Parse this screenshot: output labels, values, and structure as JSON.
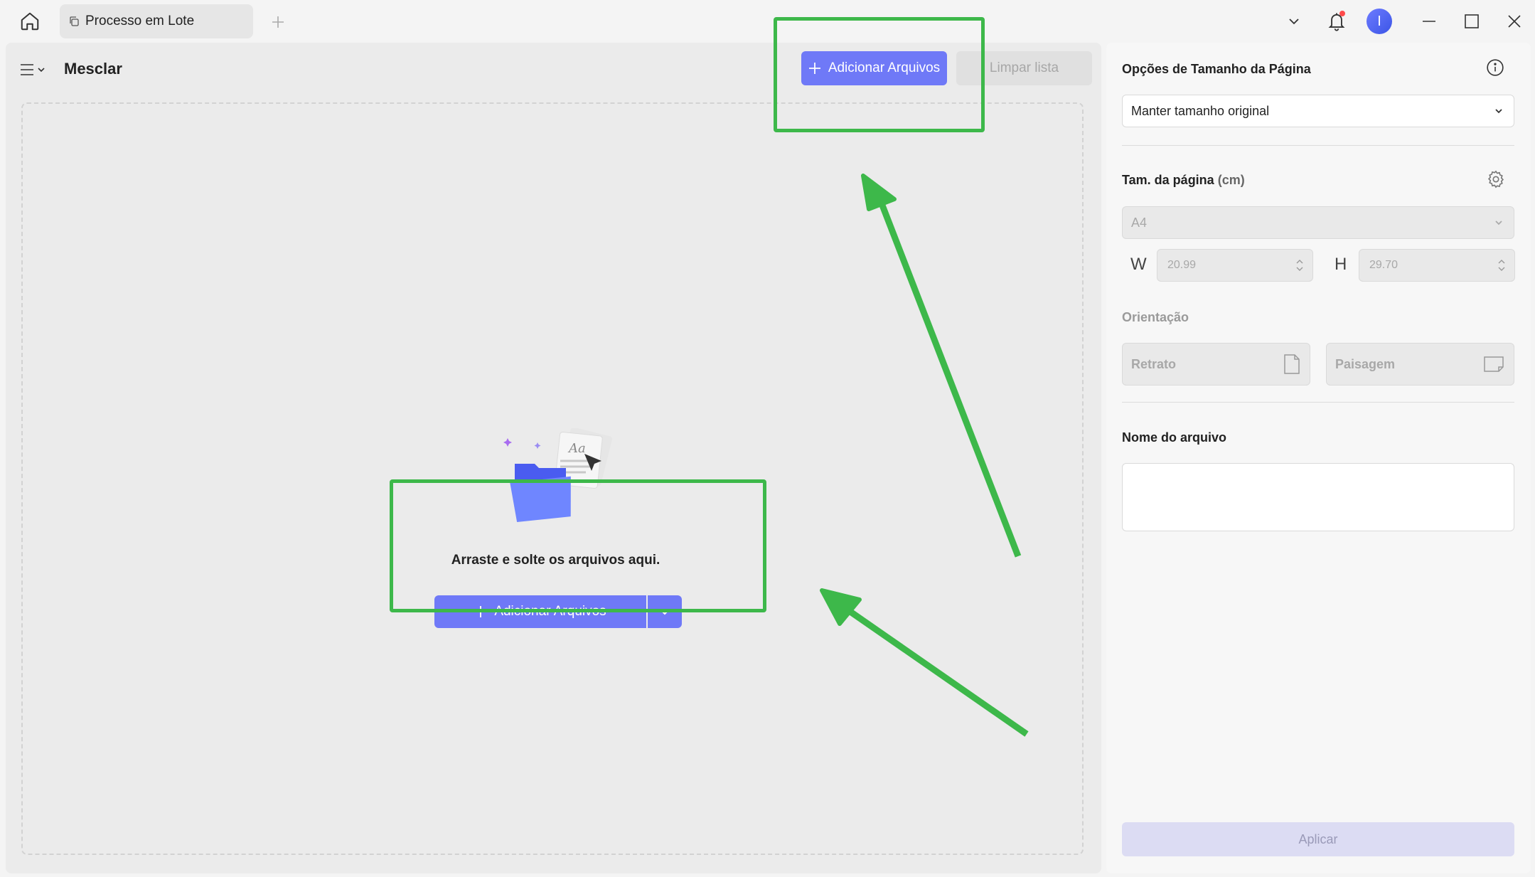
{
  "titlebar": {
    "tab_label": "Processo em Lote",
    "avatar_initial": "I"
  },
  "toolbar": {
    "title": "Mesclar",
    "add_files_label": "Adicionar Arquivos",
    "clear_list_label": "Limpar lista"
  },
  "dropzone": {
    "prompt": "Arraste e solte os arquivos aqui.",
    "add_files_label": "Adicionar Arquivos"
  },
  "side": {
    "page_size_options_title": "Opções de Tamanho da Página",
    "size_mode_value": "Manter tamanho original",
    "page_size_title": "Tam. da página",
    "page_size_unit": "(cm)",
    "paper_value": "A4",
    "width_label": "W",
    "width_value": "20.99",
    "height_label": "H",
    "height_value": "29.70",
    "orientation_title": "Orientação",
    "portrait_label": "Retrato",
    "landscape_label": "Paisagem",
    "filename_title": "Nome do arquivo",
    "filename_value": "",
    "apply_label": "Aplicar"
  },
  "colors": {
    "accent": "#6f79f7",
    "annotation": "#3db84a"
  }
}
